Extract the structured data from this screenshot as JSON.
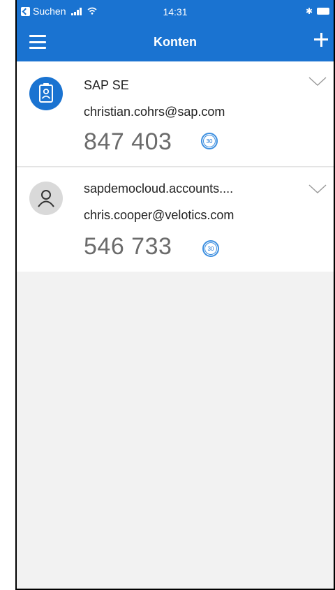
{
  "status_bar": {
    "back_app": "Suchen",
    "time": "14:31",
    "bluetooth": "✱"
  },
  "header": {
    "title": "Konten"
  },
  "accounts": [
    {
      "name": "SAP SE",
      "email": "christian.cohrs@sap.com",
      "code": "847 403",
      "timer": "30",
      "avatar_icon": "id-badge-icon"
    },
    {
      "name": "sapdemocloud.accounts....",
      "email": "chris.cooper@velotics.com",
      "code": "546 733",
      "timer": "30",
      "avatar_icon": "person-icon"
    }
  ],
  "colors": {
    "accent": "#1a73d1",
    "code_text": "#6b6b6b",
    "background": "#f2f2f2"
  }
}
